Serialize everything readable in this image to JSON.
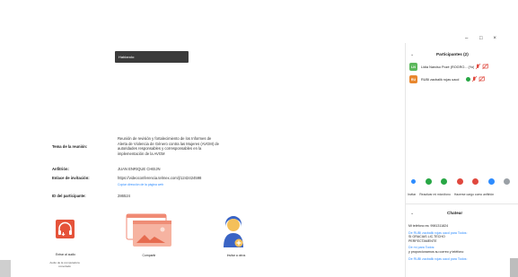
{
  "window": {
    "minimize": "–",
    "maximize": "□",
    "close": "×"
  },
  "tooltip": "Hablando:",
  "meeting": {
    "topic_label": "Tema de la reunión:",
    "topic_lines": [
      "Reunión de revisión y fortalecimiento de los Informes de",
      "Alerta de Violencia de Género contra las Mujeres (AVGM) de",
      "autoridades responsables y corresponsables en la",
      "implementación de la AVGM"
    ],
    "host_label": "Anfitrión:",
    "host_value": "JUAN ENRIQUE CHEIJN",
    "invite_label": "Enlace de invitación:",
    "invite_value": "https://videoconferencia.telmex.com/j/1242424598",
    "copy_link": "Copiar dirección de la página web",
    "pid_label": "ID del participante:",
    "pid_value": "286524"
  },
  "actions": {
    "audio_label": "Entrar al audio",
    "audio_sub_lines": [
      "Audio de la computadora",
      "conectado"
    ],
    "share_label": "Compartir",
    "invite_label": "Invitar a otros"
  },
  "participants": {
    "title": "Participantes (2)",
    "collapse_icon": "chevron-down-icon",
    "rows": [
      {
        "initials": "LN",
        "name": "Lidia Narciso Pozé (ROGRO... (Yo)",
        "avatar_color": "#5cb85c"
      },
      {
        "initials": "RU",
        "name": "RUBI zacbalik rojas  uacd",
        "avatar_color": "#e8872e"
      }
    ],
    "reaction_colors": [
      "#2d8cff",
      "#28a745",
      "#28a745",
      "#e0483e",
      "#e0483e",
      "#2d8cff",
      "#9aa0a6"
    ],
    "buttons": [
      "Invitar",
      "Reactivar mi micrófono",
      "Hacerse cargo como anfitrión"
    ]
  },
  "chat": {
    "title": "Chatear",
    "messages": [
      {
        "from": "",
        "text": "Mi teléfono es: 9981311824"
      },
      {
        "from": "De RUBI zacbalik rojas  uacd para Todos:",
        "text": "SI GRACIAS LIC.TECHO PERFECTAMENTE"
      },
      {
        "from": "De mí para Todos:",
        "text": "y proporcionarnos su correo y teléfono"
      },
      {
        "from": "De RUBI zacbalik rojas  uacd para Todos:",
        "text": ""
      }
    ]
  }
}
